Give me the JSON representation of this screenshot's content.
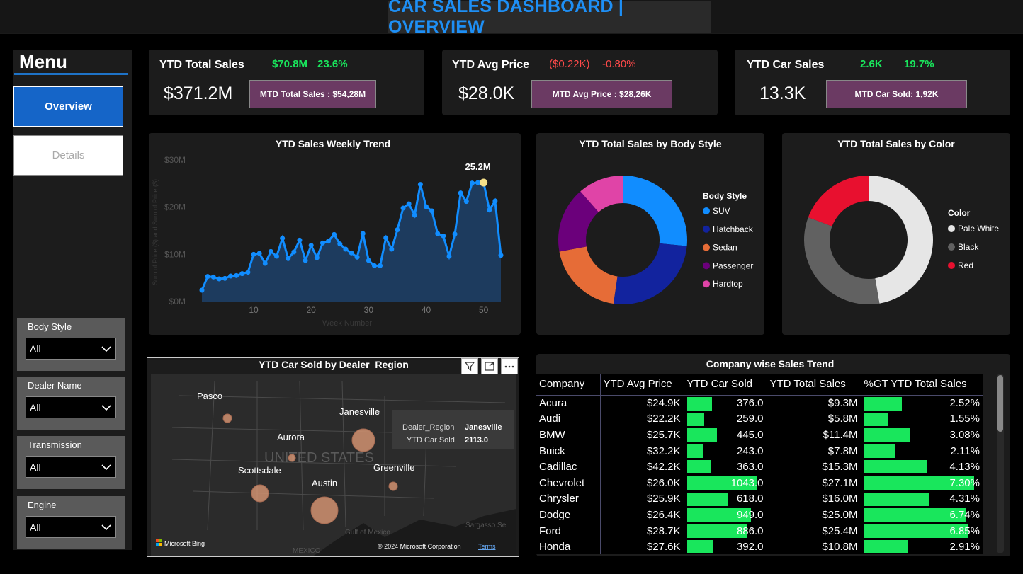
{
  "header": {
    "title": "CAR SALES DASHBOARD | OVERVIEW"
  },
  "menu": {
    "title": "Menu",
    "overview_label": "Overview",
    "details_label": "Details"
  },
  "filters": [
    {
      "label": "Body Style",
      "value": "All"
    },
    {
      "label": "Dealer Name",
      "value": "All"
    },
    {
      "label": "Transmission",
      "value": "All"
    },
    {
      "label": "Engine",
      "value": "All"
    }
  ],
  "kpis": {
    "total_sales": {
      "title": "YTD Total Sales",
      "value": "$371.2M",
      "change": "$70.8M",
      "pct": "23.6%",
      "mtd": "MTD Total Sales : $54,28M"
    },
    "avg_price": {
      "title": "YTD Avg Price",
      "value": "$28.0K",
      "change": "($0.22K)",
      "pct": "-0.80%",
      "mtd": "MTD Avg Price : $28,26K"
    },
    "car_sales": {
      "title": "YTD Car Sales",
      "value": "13.3K",
      "change": "2.6K",
      "pct": "19.7%",
      "mtd": "MTD Car Sold: 1,92K"
    }
  },
  "colors": {
    "accent": "#1e8ff5",
    "green": "#19e65c",
    "red": "#ff4a4a",
    "mtd": "#6b3a63"
  },
  "chart_data": [
    {
      "type": "area",
      "title": "YTD Sales Weekly Trend",
      "xlabel": "Week Number",
      "ylabel": "Sum of Price ($) and Sum of Price ($)",
      "y_ticks": [
        "$0M",
        "$10M",
        "$20M",
        "$30M"
      ],
      "x_ticks": [
        "10",
        "20",
        "30",
        "40",
        "50"
      ],
      "ylim": [
        0,
        30
      ],
      "xlim": [
        0,
        54
      ],
      "peak_label": "25.2M",
      "peak_week": 50,
      "x": [
        1,
        2,
        3,
        4,
        5,
        6,
        7,
        8,
        9,
        10,
        11,
        12,
        13,
        14,
        15,
        16,
        17,
        18,
        19,
        20,
        21,
        22,
        23,
        24,
        25,
        26,
        27,
        28,
        29,
        30,
        31,
        32,
        33,
        34,
        35,
        36,
        37,
        38,
        39,
        40,
        41,
        42,
        43,
        44,
        45,
        46,
        47,
        48,
        49,
        50,
        51,
        52,
        53
      ],
      "values": [
        2.4,
        5.3,
        5.2,
        4.8,
        4.9,
        5.4,
        5.5,
        5.9,
        6.2,
        10,
        10.2,
        8.1,
        10.6,
        9.6,
        13.4,
        9.1,
        10.5,
        13,
        8.7,
        11.9,
        9.3,
        12.4,
        12.8,
        14.2,
        12.2,
        11.1,
        10.3,
        9.4,
        14.4,
        8.7,
        7.6,
        7.6,
        13.5,
        11.1,
        15.2,
        19.8,
        20.7,
        18.3,
        24.8,
        20.1,
        19.2,
        14.4,
        13.9,
        9.6,
        14.3,
        23,
        21.2,
        25.1,
        25.2,
        25.2,
        19.4,
        21.3,
        9.8
      ]
    },
    {
      "type": "pie",
      "title": "YTD Total Sales by Body Style",
      "legend_title": "Body Style",
      "labels": [
        "SUV",
        "Hatchback",
        "Sedan",
        "Passenger",
        "Hardtop"
      ],
      "values": [
        26.5,
        25.8,
        19.8,
        16.5,
        11.4
      ],
      "colors": [
        "#118dff",
        "#12239e",
        "#e66c37",
        "#6b007b",
        "#e044a7"
      ]
    },
    {
      "type": "pie",
      "title": "YTD Total Sales by Color",
      "legend_title": "Color",
      "labels": [
        "Pale White",
        "Black",
        "Red"
      ],
      "values": [
        47.3,
        33.4,
        19.3
      ],
      "colors": [
        "#e6e6e6",
        "#616161",
        "#e8102f"
      ]
    },
    {
      "type": "table",
      "title": "Company wise Sales Trend",
      "columns": [
        "Company",
        "YTD Avg Price",
        "YTD Car Sold",
        "YTD Total Sales",
        "%GT YTD Total Sales"
      ],
      "rows": [
        {
          "company": "Acura",
          "avg": "$24.9K",
          "sold": "376.0",
          "sold_v": 376,
          "total": "$9.3M",
          "pct": "2.52%",
          "pct_v": 2.52
        },
        {
          "company": "Audi",
          "avg": "$22.2K",
          "sold": "259.0",
          "sold_v": 259,
          "total": "$5.8M",
          "pct": "1.55%",
          "pct_v": 1.55
        },
        {
          "company": "BMW",
          "avg": "$25.7K",
          "sold": "445.0",
          "sold_v": 445,
          "total": "$11.4M",
          "pct": "3.08%",
          "pct_v": 3.08
        },
        {
          "company": "Buick",
          "avg": "$32.2K",
          "sold": "243.0",
          "sold_v": 243,
          "total": "$7.8M",
          "pct": "2.11%",
          "pct_v": 2.11
        },
        {
          "company": "Cadillac",
          "avg": "$42.2K",
          "sold": "363.0",
          "sold_v": 363,
          "total": "$15.3M",
          "pct": "4.13%",
          "pct_v": 4.13
        },
        {
          "company": "Chevrolet",
          "avg": "$26.0K",
          "sold": "1043.0",
          "sold_v": 1043,
          "total": "$27.1M",
          "pct": "7.30%",
          "pct_v": 7.3
        },
        {
          "company": "Chrysler",
          "avg": "$25.9K",
          "sold": "618.0",
          "sold_v": 618,
          "total": "$16.0M",
          "pct": "4.31%",
          "pct_v": 4.31
        },
        {
          "company": "Dodge",
          "avg": "$26.4K",
          "sold": "949.0",
          "sold_v": 949,
          "total": "$25.0M",
          "pct": "6.74%",
          "pct_v": 6.74
        },
        {
          "company": "Ford",
          "avg": "$28.7K",
          "sold": "886.0",
          "sold_v": 886,
          "total": "$25.4M",
          "pct": "6.85%",
          "pct_v": 6.85
        },
        {
          "company": "Honda",
          "avg": "$27.6K",
          "sold": "392.0",
          "sold_v": 392,
          "total": "$10.8M",
          "pct": "2.91%",
          "pct_v": 2.91
        }
      ]
    },
    {
      "type": "scatter",
      "title": "YTD Car Sold by Dealer_Region",
      "points": [
        {
          "label": "Pasco",
          "value": 1500
        },
        {
          "label": "Janesville",
          "value": 2113
        },
        {
          "label": "Aurora",
          "value": 1200
        },
        {
          "label": "Scottsdale",
          "value": 1700
        },
        {
          "label": "Greenville",
          "value": 1400
        },
        {
          "label": "Austin",
          "value": 2200
        }
      ]
    }
  ],
  "map": {
    "country_label": "UNITED STATES",
    "gulf_label": "Gulf of Mexico",
    "mexico_label": "MEXICO",
    "sargasso_label": "Sargasso Se",
    "bing_label": "Microsoft Bing",
    "copyright": "© 2024 Microsoft Corporation",
    "terms": "Terms",
    "tooltip": {
      "k1": "Dealer_Region",
      "v1": "Janesville",
      "k2": "YTD Car Sold",
      "v2": "2113.0"
    }
  }
}
